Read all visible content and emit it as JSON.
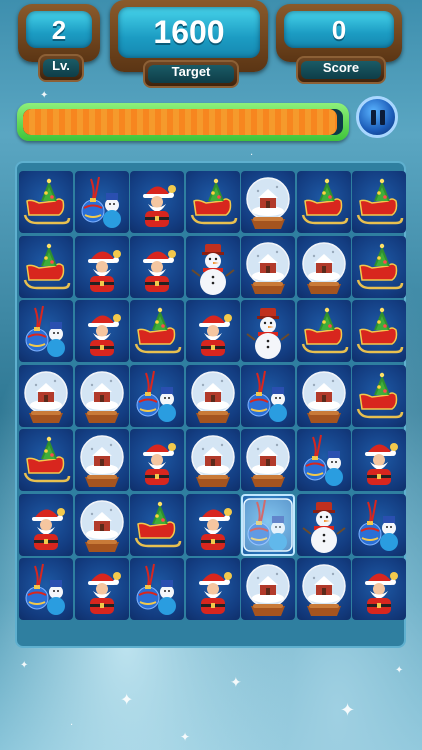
{
  "hud": {
    "level": {
      "value": "2",
      "label": "Lv."
    },
    "target": {
      "value": "1600",
      "label": "Target"
    },
    "score": {
      "value": "0",
      "label": "Score"
    }
  },
  "progress": {
    "fill_fraction": 0.98
  },
  "pause_button": {
    "icon": "pause-icon"
  },
  "board": {
    "rows": 7,
    "cols": 7,
    "tiles": [
      [
        "sleigh",
        "ornament-snowman",
        "santa",
        "sleigh",
        "snow-globe",
        "sleigh",
        "sleigh"
      ],
      [
        "sleigh",
        "santa",
        "santa",
        "snowman",
        "snow-globe",
        "snow-globe",
        "sleigh"
      ],
      [
        "ornament-snowman",
        "santa",
        "sleigh",
        "santa",
        "snowman",
        "sleigh",
        "sleigh"
      ],
      [
        "snow-globe",
        "snow-globe",
        "ornament-snowman",
        "snow-globe",
        "ornament-snowman",
        "snow-globe",
        "sleigh"
      ],
      [
        "sleigh",
        "snow-globe",
        "santa",
        "snow-globe",
        "snow-globe",
        "ornament-snowman",
        "santa"
      ],
      [
        "santa",
        "snow-globe",
        "sleigh",
        "santa",
        "ornament-snowman-iced",
        "snowman",
        "ornament-snowman"
      ],
      [
        "ornament-snowman",
        "santa",
        "ornament-snowman",
        "santa",
        "snow-globe",
        "snow-globe",
        "santa"
      ]
    ]
  },
  "colors": {
    "board_bg": "#2f7fa0",
    "tile_bg": "#133c80",
    "progress_fill": "#f7861f",
    "progress_frame": "#3ec43a",
    "panel_screen": "#1c9cc3",
    "wood": "#5b3514"
  }
}
